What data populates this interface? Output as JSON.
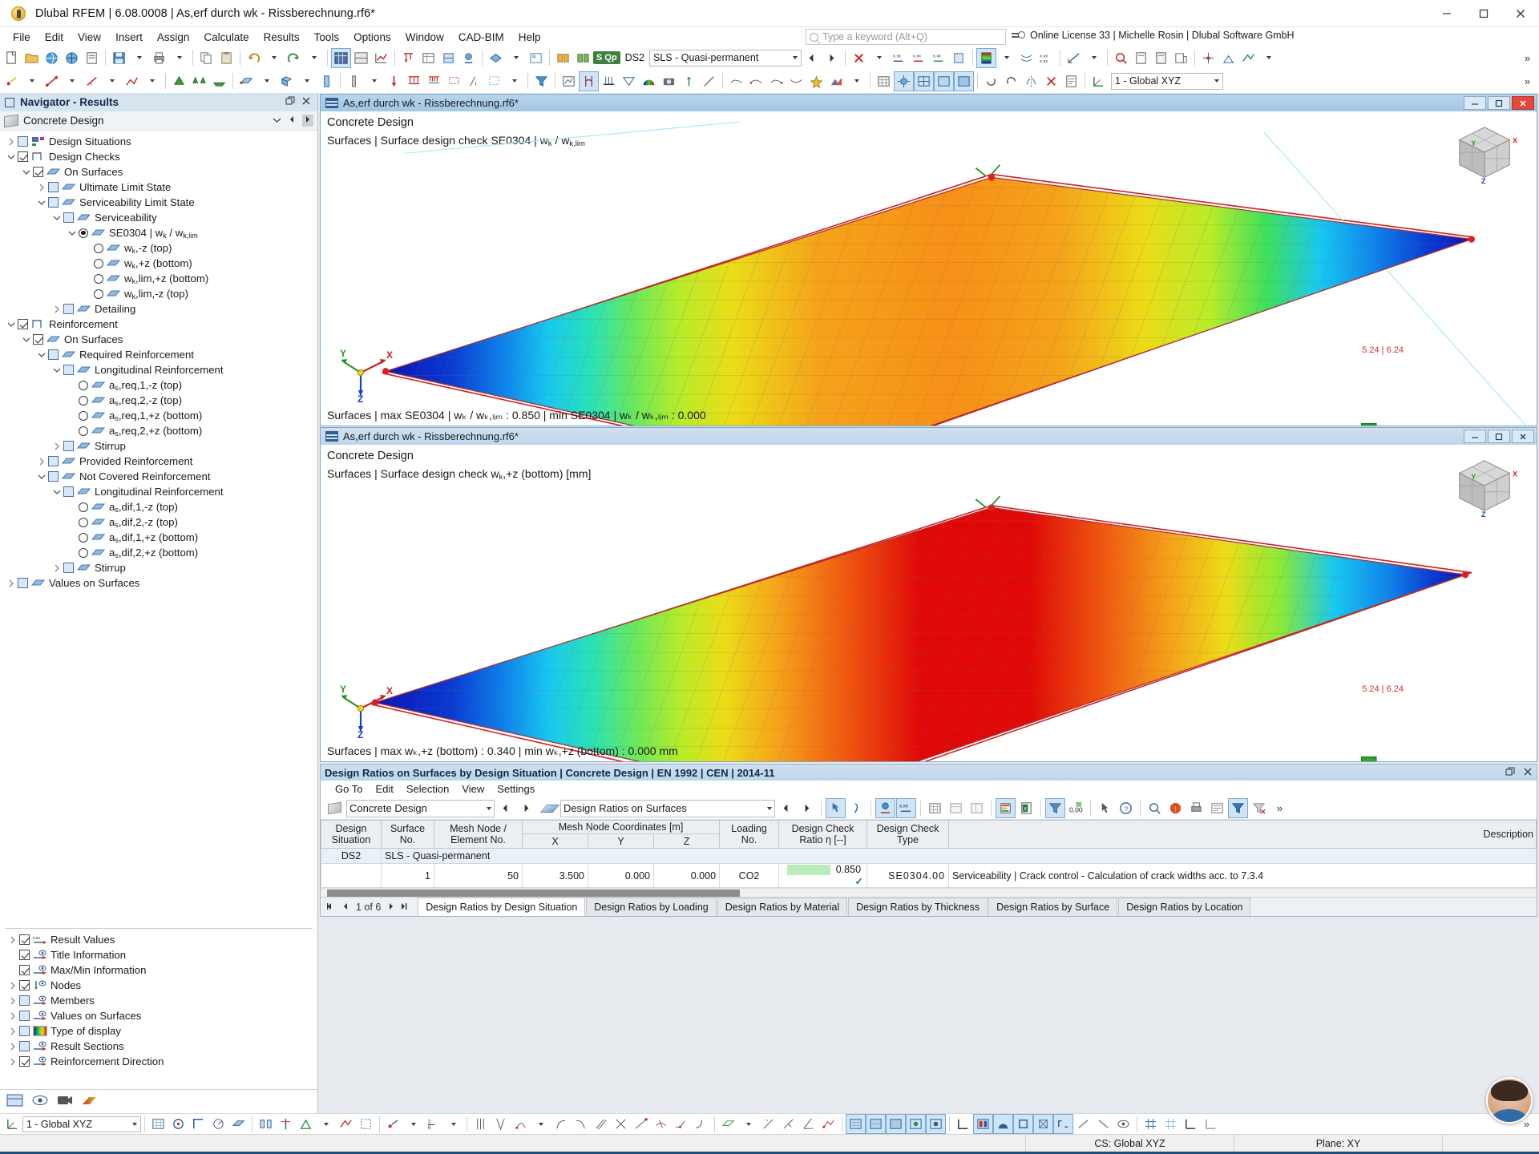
{
  "window": {
    "title": "Dlubal RFEM | 6.08.0008 | As,erf durch wk - Rissberechnung.rf6*",
    "minimize": "–",
    "maximize": "□",
    "close": "✕"
  },
  "menu": {
    "items": [
      "File",
      "Edit",
      "View",
      "Insert",
      "Assign",
      "Calculate",
      "Results",
      "Tools",
      "Options",
      "Window",
      "CAD-BIM",
      "Help"
    ],
    "search_placeholder": "Type a keyword (Alt+Q)",
    "license": "Online License 33 | Michelle Rosin | Dlubal Software GmbH"
  },
  "toolbar": {
    "design_situation_tag": "S Qp",
    "design_situation_code": "DS2",
    "design_situation_name": "SLS - Quasi-permanent",
    "coordinate_system": "1 - Global XYZ",
    "overflow": "»"
  },
  "navigator": {
    "header": "Navigator - Results",
    "module": "Concrete Design",
    "tree": [
      {
        "depth": 0,
        "expander": "collapsed",
        "control": "checkbox",
        "checked": false,
        "label": "Design Situations",
        "icon": "design-situations-icon"
      },
      {
        "depth": 0,
        "expander": "expanded",
        "control": "checkbox",
        "checked": true,
        "label": "Design Checks",
        "icon": "design-checks-icon"
      },
      {
        "depth": 1,
        "expander": "expanded",
        "control": "checkbox",
        "checked": true,
        "label": "On Surfaces",
        "icon": "surface-icon"
      },
      {
        "depth": 2,
        "expander": "collapsed",
        "control": "checkbox",
        "checked": false,
        "label": "Ultimate Limit State",
        "icon": "surface-icon"
      },
      {
        "depth": 2,
        "expander": "expanded",
        "control": "checkbox",
        "checked": false,
        "label": "Serviceability Limit State",
        "icon": "surface-icon"
      },
      {
        "depth": 3,
        "expander": "expanded",
        "control": "checkbox",
        "checked": false,
        "label": "Serviceability",
        "icon": "surface-icon"
      },
      {
        "depth": 4,
        "expander": "expanded",
        "control": "radio",
        "checked": true,
        "label": "SE0304 | w<sub>k</sub> / w<sub>k,lim</sub>",
        "icon": "surface-icon"
      },
      {
        "depth": 5,
        "expander": "none",
        "control": "radio",
        "checked": false,
        "label": "w<sub>k</sub>,-z (top)",
        "icon": "surface-icon"
      },
      {
        "depth": 5,
        "expander": "none",
        "control": "radio",
        "checked": false,
        "label": "w<sub>k</sub>,+z (bottom)",
        "icon": "surface-icon"
      },
      {
        "depth": 5,
        "expander": "none",
        "control": "radio",
        "checked": false,
        "label": "w<sub>k</sub>,lim,+z (bottom)",
        "icon": "surface-icon"
      },
      {
        "depth": 5,
        "expander": "none",
        "control": "radio",
        "checked": false,
        "label": "w<sub>k</sub>,lim,-z (top)",
        "icon": "surface-icon"
      },
      {
        "depth": 3,
        "expander": "collapsed",
        "control": "checkbox",
        "checked": false,
        "label": "Detailing",
        "icon": "surface-icon"
      },
      {
        "depth": 0,
        "expander": "expanded",
        "control": "checkbox",
        "checked": true,
        "label": "Reinforcement",
        "icon": "design-checks-icon"
      },
      {
        "depth": 1,
        "expander": "expanded",
        "control": "checkbox",
        "checked": true,
        "label": "On Surfaces",
        "icon": "surface-icon"
      },
      {
        "depth": 2,
        "expander": "expanded",
        "control": "checkbox",
        "checked": false,
        "label": "Required Reinforcement",
        "icon": "surface-icon"
      },
      {
        "depth": 3,
        "expander": "expanded",
        "control": "checkbox",
        "checked": false,
        "label": "Longitudinal Reinforcement",
        "icon": "surface-icon"
      },
      {
        "depth": 4,
        "expander": "none",
        "control": "radio",
        "checked": false,
        "label": "a<sub>s</sub>,req,1,-z (top)",
        "icon": "surface-icon"
      },
      {
        "depth": 4,
        "expander": "none",
        "control": "radio",
        "checked": false,
        "label": "a<sub>s</sub>,req,2,-z (top)",
        "icon": "surface-icon"
      },
      {
        "depth": 4,
        "expander": "none",
        "control": "radio",
        "checked": false,
        "label": "a<sub>s</sub>,req,1,+z (bottom)",
        "icon": "surface-icon"
      },
      {
        "depth": 4,
        "expander": "none",
        "control": "radio",
        "checked": false,
        "label": "a<sub>s</sub>,req,2,+z (bottom)",
        "icon": "surface-icon"
      },
      {
        "depth": 3,
        "expander": "collapsed",
        "control": "checkbox",
        "checked": false,
        "label": "Stirrup",
        "icon": "surface-icon"
      },
      {
        "depth": 2,
        "expander": "collapsed",
        "control": "checkbox",
        "checked": false,
        "label": "Provided Reinforcement",
        "icon": "surface-icon"
      },
      {
        "depth": 2,
        "expander": "expanded",
        "control": "checkbox",
        "checked": false,
        "label": "Not Covered Reinforcement",
        "icon": "surface-icon"
      },
      {
        "depth": 3,
        "expander": "expanded",
        "control": "checkbox",
        "checked": false,
        "label": "Longitudinal Reinforcement",
        "icon": "surface-icon"
      },
      {
        "depth": 4,
        "expander": "none",
        "control": "radio",
        "checked": false,
        "label": "a<sub>s</sub>,dif,1,-z (top)",
        "icon": "surface-icon"
      },
      {
        "depth": 4,
        "expander": "none",
        "control": "radio",
        "checked": false,
        "label": "a<sub>s</sub>,dif,2,-z (top)",
        "icon": "surface-icon"
      },
      {
        "depth": 4,
        "expander": "none",
        "control": "radio",
        "checked": false,
        "label": "a<sub>s</sub>,dif,1,+z (bottom)",
        "icon": "surface-icon"
      },
      {
        "depth": 4,
        "expander": "none",
        "control": "radio",
        "checked": false,
        "label": "a<sub>s</sub>,dif,2,+z (bottom)",
        "icon": "surface-icon"
      },
      {
        "depth": 3,
        "expander": "collapsed",
        "control": "checkbox",
        "checked": false,
        "label": "Stirrup",
        "icon": "surface-icon"
      },
      {
        "depth": 0,
        "expander": "collapsed",
        "control": "checkbox",
        "checked": false,
        "label": "Values on Surfaces",
        "icon": "surface-icon"
      }
    ],
    "display_options": [
      {
        "expander": "collapsed",
        "checked": true,
        "label": "Result Values",
        "icon": "result-values-icon"
      },
      {
        "expander": "none",
        "checked": true,
        "label": "Title Information",
        "icon": "eye-icon"
      },
      {
        "expander": "none",
        "checked": true,
        "label": "Max/Min Information",
        "icon": "eye-icon"
      },
      {
        "expander": "collapsed",
        "checked": true,
        "label": "Nodes",
        "icon": "node-icon"
      },
      {
        "expander": "collapsed",
        "checked": false,
        "label": "Members",
        "icon": "eye-icon"
      },
      {
        "expander": "collapsed",
        "checked": false,
        "label": "Values on Surfaces",
        "icon": "eye-icon"
      },
      {
        "expander": "collapsed",
        "checked": false,
        "label": "Type of display",
        "icon": "color-scale-icon"
      },
      {
        "expander": "collapsed",
        "checked": false,
        "label": "Result Sections",
        "icon": "eye-icon"
      },
      {
        "expander": "collapsed",
        "checked": true,
        "label": "Reinforcement Direction",
        "icon": "eye-icon"
      }
    ]
  },
  "viewport_top": {
    "title": "As,erf durch wk - Rissberechnung.rf6*",
    "head_line1": "Concrete Design",
    "head_line2_prefix": "Surfaces | Surface design check SE0304 | w",
    "head_line2_sub1": "k",
    "head_line2_mid": " / w",
    "head_line2_sub2": "k,lim",
    "footer": "Surfaces | max SE0304 | wₖ / wₖ,ₗᵢₘ : 0.850 | min SE0304 | wₖ / wₖ,ₗᵢₘ : 0.000",
    "footer_max_value": "0.850",
    "footer_min_value": "0.000",
    "axis_x": "X",
    "axis_y": "Y",
    "axis_z": "Z",
    "annotation": "5.24 | 6.24",
    "minimize": "–",
    "maximize": "□",
    "close": "✕"
  },
  "viewport_bottom": {
    "title": "As,erf durch wk - Rissberechnung.rf6*",
    "head_line1": "Concrete Design",
    "head_line2_prefix": "Surfaces | Surface design check w",
    "head_line2_sub": "k",
    "head_line2_suffix": ",+z (bottom) [mm]",
    "footer": "Surfaces | max wₖ,+z (bottom) : 0.340 | min wₖ,+z (bottom) : 0.000 mm",
    "footer_max_value": "0.340",
    "footer_min_value": "0.000",
    "unit": "mm",
    "axis_x": "X",
    "axis_y": "Y",
    "axis_z": "Z",
    "annotation": "5.24 | 6.24",
    "minimize": "–",
    "maximize": "□",
    "close": "✕"
  },
  "table_panel": {
    "title": "Design Ratios on Surfaces by Design Situation | Concrete Design | EN 1992 | CEN | 2014-11",
    "menu": [
      "Go To",
      "Edit",
      "Selection",
      "View",
      "Settings"
    ],
    "combo_left": "Concrete Design",
    "combo_right": "Design Ratios on Surfaces",
    "columns": [
      {
        "label": "Design Situation",
        "group": null
      },
      {
        "label": "Surface No.",
        "group": null
      },
      {
        "label": "Mesh Node / Element No.",
        "group": null
      },
      {
        "label": "X",
        "group": "Mesh Node Coordinates [m]"
      },
      {
        "label": "Y",
        "group": "Mesh Node Coordinates [m]"
      },
      {
        "label": "Z",
        "group": "Mesh Node Coordinates [m]"
      },
      {
        "label": "Loading No.",
        "group": null
      },
      {
        "label": "Design Check Ratio η [--]",
        "group": null
      },
      {
        "label": "Design Check Type",
        "group": null
      },
      {
        "label": "Description",
        "group": null
      }
    ],
    "group_header_label": "Mesh Node Coordinates [m]",
    "group_row": {
      "ds": "DS2",
      "text": "SLS - Quasi-permanent"
    },
    "rows": [
      {
        "ds": "",
        "surface_no": "1",
        "mesh_node": "50",
        "x": "3.500",
        "y": "0.000",
        "z": "0.000",
        "loading_no": "CO2",
        "ratio": "0.850",
        "ratio_ok": "✓",
        "check_type": "SE0304.00",
        "description": "Serviceability | Crack control - Calculation of crack widths acc. to 7.3.4"
      }
    ],
    "description_header": "Description",
    "pager": "1 of 6",
    "tabs": [
      {
        "label": "Design Ratios by Design Situation",
        "active": true
      },
      {
        "label": "Design Ratios by Loading",
        "active": false
      },
      {
        "label": "Design Ratios by Material",
        "active": false
      },
      {
        "label": "Design Ratios by Thickness",
        "active": false
      },
      {
        "label": "Design Ratios by Surface",
        "active": false
      },
      {
        "label": "Design Ratios by Location",
        "active": false
      }
    ]
  },
  "statusbar": {
    "coordinate_system": "CS: Global XYZ",
    "plane": "Plane: XY",
    "cs_selector": "1 - Global XYZ"
  },
  "colors": {
    "accent": "#1f4e79",
    "titlebar_active": "#a3c6e4",
    "ok_green": "#17902b",
    "ratio_bar": "#b9ecb9",
    "close_red": "#e24b3c"
  },
  "chart_data": {
    "type": "heatmap",
    "title": "Surface design check SE0304 | wk / wk,lim",
    "colorbar": [
      "#0000c8",
      "#0050ff",
      "#00b4ff",
      "#00ffc8",
      "#64ff32",
      "#c8ff00",
      "#ffe600",
      "#ffa000",
      "#ff5000",
      "#e00000"
    ],
    "top_plot": {
      "max": 0.85,
      "min": 0.0,
      "unit": "-",
      "label": "wk / wk,lim"
    },
    "bottom_plot": {
      "max": 0.34,
      "min": 0.0,
      "unit": "mm",
      "label": "wk,+z (bottom)"
    }
  }
}
